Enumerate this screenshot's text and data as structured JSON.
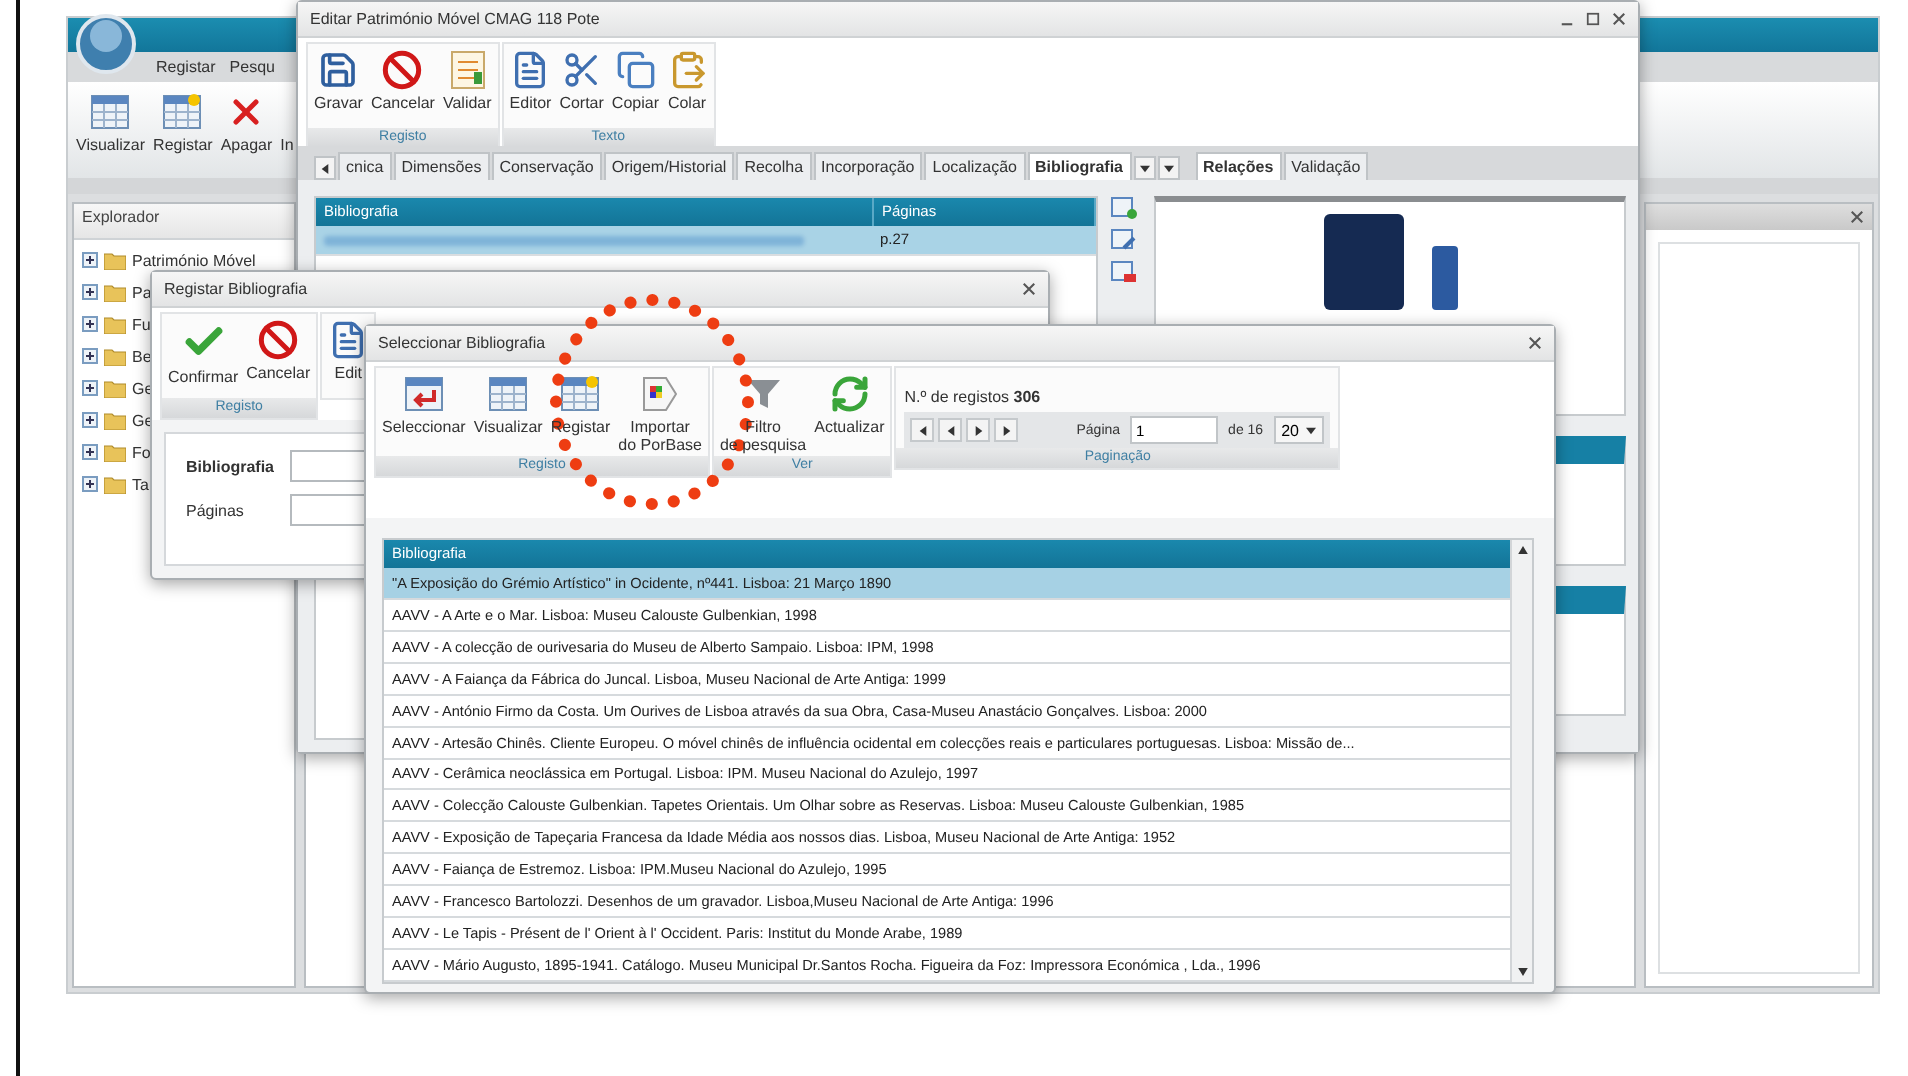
{
  "main": {
    "menu": [
      "Registar",
      "Pesqu"
    ],
    "toolbar": [
      {
        "label": "Visualizar",
        "kind": "grid"
      },
      {
        "label": "Registar",
        "kind": "grid-new"
      },
      {
        "label": "Apagar",
        "kind": "delete"
      },
      {
        "label": "In",
        "kind": "none"
      }
    ],
    "explorer": {
      "title": "Explorador",
      "items": [
        {
          "label": "Património Móvel",
          "expanded": false
        },
        {
          "label": "Pa",
          "expanded": false
        },
        {
          "label": "Fu",
          "expanded": false
        },
        {
          "label": "Be",
          "expanded": false
        },
        {
          "label": "Ge",
          "expanded": false
        },
        {
          "label": "Ge",
          "expanded": false
        },
        {
          "label": "Fo",
          "expanded": false
        },
        {
          "label": "Ta",
          "expanded": false
        }
      ]
    }
  },
  "editor_window": {
    "title": "Editar Património Móvel CMAG 118 Pote",
    "groups": [
      {
        "label": "Registo",
        "buttons": [
          {
            "label": "Gravar",
            "kind": "save"
          },
          {
            "label": "Cancelar",
            "kind": "cancel"
          },
          {
            "label": "Validar",
            "kind": "validate"
          }
        ]
      },
      {
        "label": "Texto",
        "buttons": [
          {
            "label": "Editor",
            "kind": "editor"
          },
          {
            "label": "Cortar",
            "kind": "cut"
          },
          {
            "label": "Copiar",
            "kind": "copy"
          },
          {
            "label": "Colar",
            "kind": "paste"
          }
        ]
      }
    ],
    "tabs": [
      {
        "label": "cnica",
        "selected": false
      },
      {
        "label": "Dimensões",
        "selected": false
      },
      {
        "label": "Conservação",
        "selected": false
      },
      {
        "label": "Origem/Historial",
        "selected": false
      },
      {
        "label": "Recolha",
        "selected": false
      },
      {
        "label": "Incorporação",
        "selected": false
      },
      {
        "label": "Localização",
        "selected": false
      },
      {
        "label": "Bibliografia",
        "selected": true
      }
    ],
    "side_tabs": [
      {
        "label": "Relações",
        "selected": true
      },
      {
        "label": "Validação",
        "selected": false
      }
    ],
    "grid": {
      "columns": [
        "Bibliografia",
        "Páginas"
      ],
      "rows": [
        {
          "pages": "p.27",
          "selected": true
        }
      ]
    }
  },
  "register_window": {
    "title": "Registar Bibliografia",
    "groups": [
      {
        "label": "Registo",
        "buttons": [
          {
            "label": "Confirmar",
            "kind": "confirm"
          },
          {
            "label": "Cancelar",
            "kind": "cancel"
          }
        ]
      }
    ],
    "partial_buttons": [
      {
        "label": "Edit",
        "kind": "editor"
      }
    ],
    "fields": [
      {
        "label": "Bibliografia",
        "bold": true
      },
      {
        "label": "Páginas",
        "bold": false
      }
    ]
  },
  "select_window": {
    "title": "Seleccionar Bibliografia",
    "groups": [
      {
        "label": "Registo",
        "buttons": [
          {
            "label": "Seleccionar",
            "kind": "select"
          },
          {
            "label": "Visualizar",
            "kind": "grid"
          },
          {
            "label": "Registar",
            "kind": "grid-new"
          },
          {
            "label": "Importar\ndo PorBase",
            "kind": "import"
          }
        ]
      },
      {
        "label": "Ver",
        "buttons": [
          {
            "label": "Filtro\nde pesquisa",
            "kind": "filter"
          },
          {
            "label": "Actualizar",
            "kind": "refresh"
          }
        ]
      }
    ],
    "pagination": {
      "label": "Paginação",
      "records_label": "N.º de registos",
      "records_count": "306",
      "page_label": "Página",
      "page_value": "1",
      "page_total": "de 16",
      "page_size": "20"
    },
    "grid": {
      "column": "Bibliografia",
      "rows": [
        {
          "text": "\"A Exposição do Grémio Artístico\" in Ocidente, nº441. Lisboa: 21 Março 1890",
          "selected": true
        },
        {
          "text": "AAVV - A Arte e o Mar. Lisboa: Museu Calouste Gulbenkian, 1998",
          "selected": false
        },
        {
          "text": "AAVV - A colecção de ourivesaria do Museu de Alberto Sampaio. Lisboa: IPM, 1998",
          "selected": false
        },
        {
          "text": "AAVV - A Faiança da Fábrica do Juncal. Lisboa, Museu Nacional de Arte Antiga: 1999",
          "selected": false
        },
        {
          "text": "AAVV - António Firmo da Costa. Um Ourives de Lisboa através da sua Obra, Casa-Museu Anastácio Gonçalves. Lisboa: 2000",
          "selected": false
        },
        {
          "text": "AAVV - Artesão Chinês. Cliente Europeu. O móvel chinês de influência ocidental em colecções reais e particulares portuguesas. Lisboa: Missão de...",
          "selected": false
        },
        {
          "text": "AAVV - Cerâmica neoclássica em Portugal. Lisboa: IPM. Museu Nacional do Azulejo, 1997",
          "selected": false
        },
        {
          "text": "AAVV - Colecção Calouste Gulbenkian. Tapetes Orientais. Um Olhar sobre as Reservas. Lisboa: Museu Calouste Gulbenkian, 1985",
          "selected": false
        },
        {
          "text": "AAVV - Exposição de Tapeçaria Francesa da Idade Média aos nossos dias. Lisboa, Museu Nacional de Arte Antiga: 1952",
          "selected": false
        },
        {
          "text": "AAVV - Faiança de Estremoz. Lisboa: IPM.Museu Nacional do Azulejo, 1995",
          "selected": false
        },
        {
          "text": "AAVV - Francesco Bartolozzi. Desenhos de um gravador. Lisboa,Museu Nacional de Arte Antiga: 1996",
          "selected": false
        },
        {
          "text": "AAVV - Le Tapis - Présent de l' Orient à l' Occident. Paris: Institut du Monde Arabe, 1989",
          "selected": false
        },
        {
          "text": "AAVV - Mário Augusto, 1895-1941. Catálogo. Museu Municipal Dr.Santos Rocha. Figueira da Foz: Impressora Económica , Lda., 1996",
          "selected": false
        }
      ]
    }
  }
}
